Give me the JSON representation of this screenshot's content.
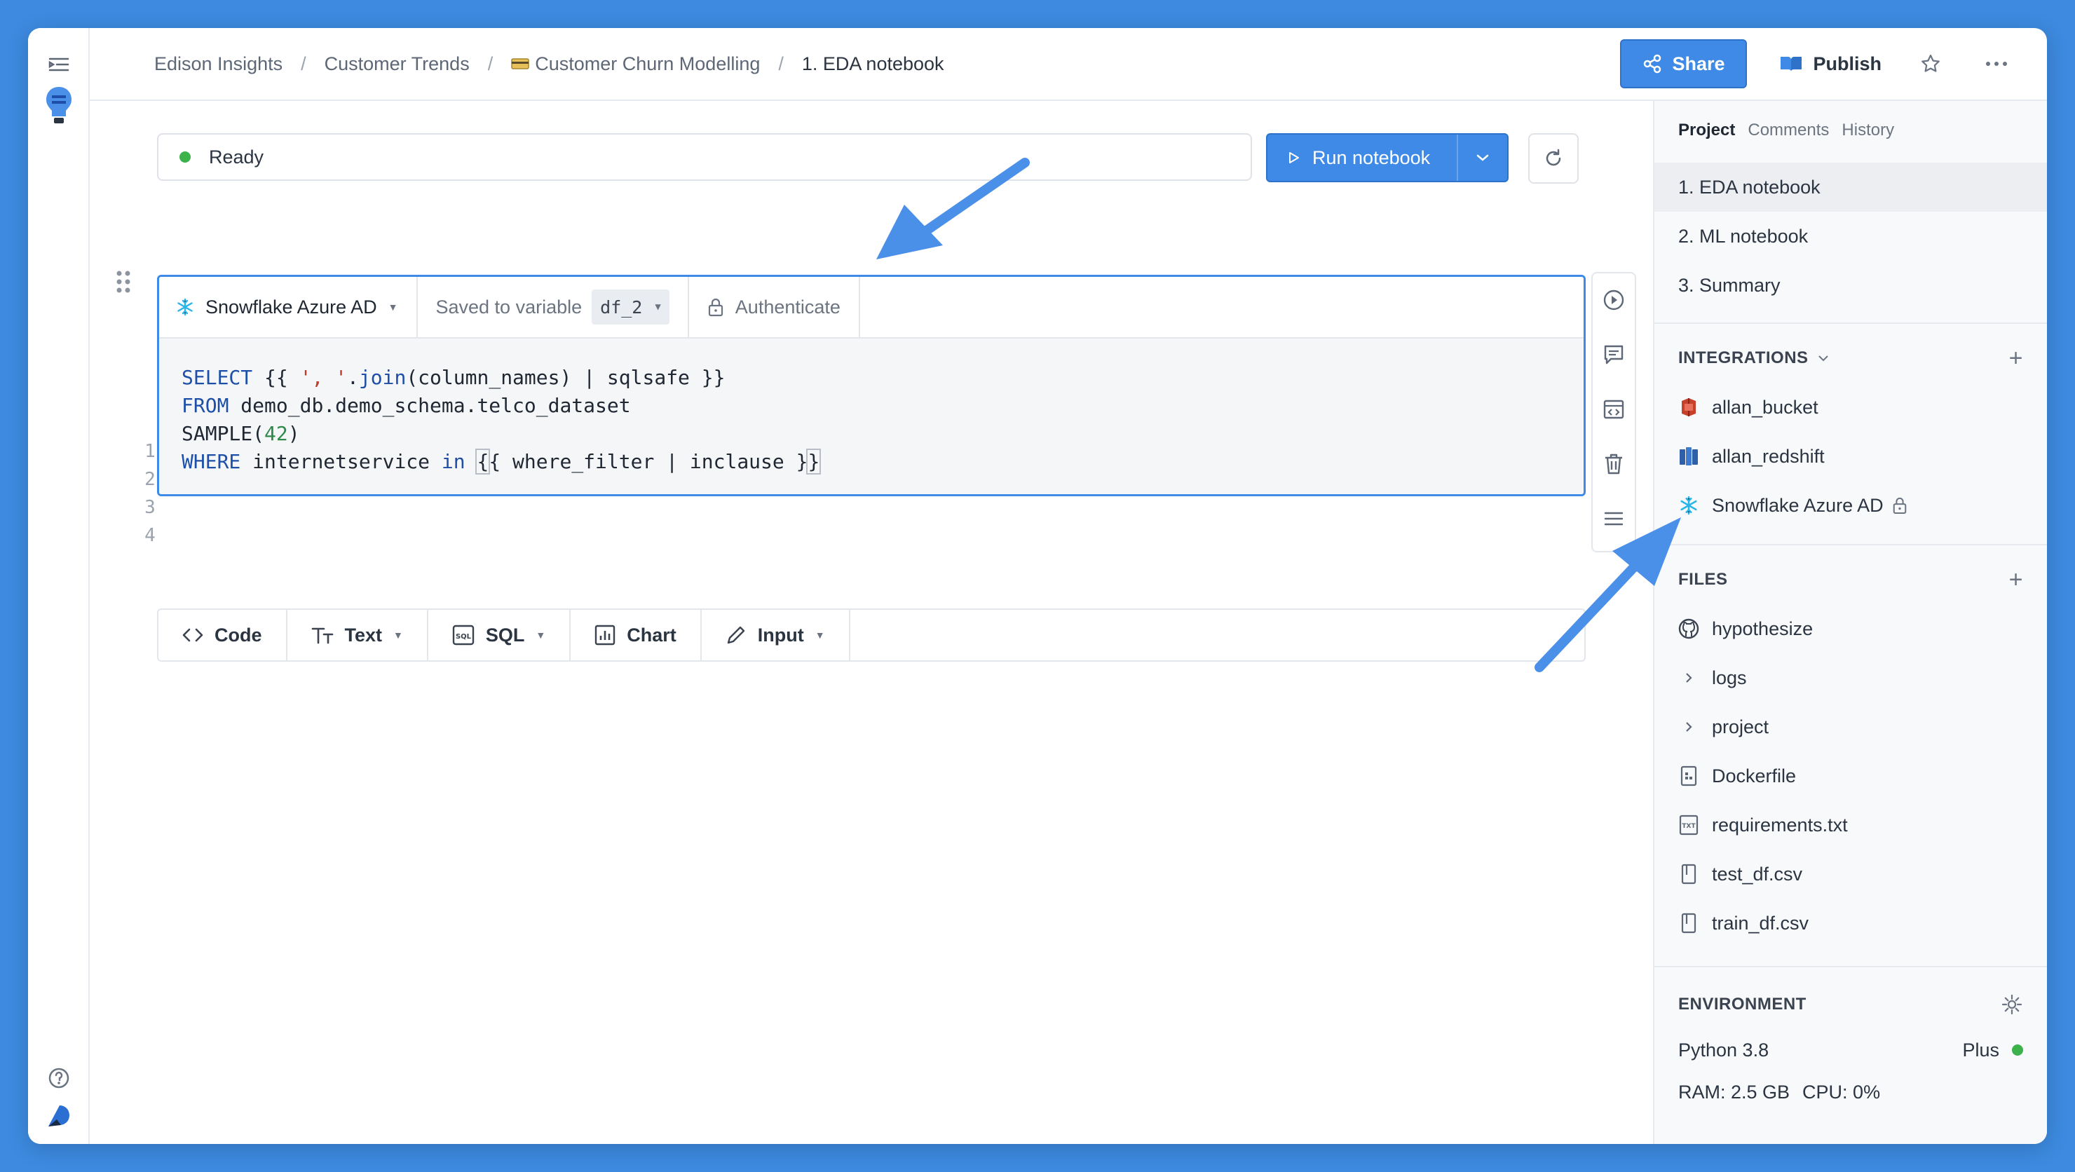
{
  "breadcrumb": {
    "items": [
      "Edison Insights",
      "Customer Trends",
      "Customer Churn Modelling",
      "1. EDA notebook"
    ],
    "separator": "/"
  },
  "header": {
    "share_label": "Share",
    "publish_label": "Publish"
  },
  "status": {
    "text": "Ready",
    "color": "#3db24b"
  },
  "run": {
    "label": "Run notebook"
  },
  "cell": {
    "source_label": "Snowflake Azure AD",
    "saved_label": "Saved to variable",
    "variable": "df_2",
    "auth_label": "Authenticate",
    "line_numbers": [
      "1",
      "2",
      "3",
      "4"
    ],
    "code": {
      "l1_kw": "SELECT",
      "l1_a": " {{ ",
      "l1_str": "', '",
      "l1_dot": ".",
      "l1_fn": "join",
      "l1_b": "(column_names) | sqlsafe }}",
      "l2_kw": "FROM",
      "l2_a": " demo_db.demo_schema.telco_dataset",
      "l3_a": "SAMPLE(",
      "l3_num": "42",
      "l3_b": ")",
      "l4_kw": "WHERE",
      "l4_a": " internetservice ",
      "l4_kw2": "in",
      "l4_b": " ",
      "l4_brace1": "{",
      "l4_c": "{ where_filter | inclause }",
      "l4_brace2": "}"
    }
  },
  "add_bar": {
    "code": "Code",
    "text": "Text",
    "sql": "SQL",
    "chart": "Chart",
    "input": "Input"
  },
  "sidebar": {
    "tabs": [
      "Project",
      "Comments",
      "History"
    ],
    "notebooks": [
      "1. EDA notebook",
      "2. ML notebook",
      "3. Summary"
    ],
    "integrations_title": "INTEGRATIONS",
    "integrations": [
      "allan_bucket",
      "allan_redshift",
      "Snowflake Azure AD"
    ],
    "files_title": "FILES",
    "files": [
      "hypothesize",
      "logs",
      "project",
      "Dockerfile",
      "requirements.txt",
      "test_df.csv",
      "train_df.csv"
    ],
    "environment_title": "ENVIRONMENT",
    "python": "Python 3.8",
    "plan": "Plus",
    "ram": "RAM: 2.5 GB",
    "cpu": "CPU: 0%"
  },
  "colors": {
    "accent": "#3e8ae6",
    "background": "#3d8ae0",
    "status_green": "#3db24b",
    "annotation_arrow": "#4a8fe8"
  }
}
